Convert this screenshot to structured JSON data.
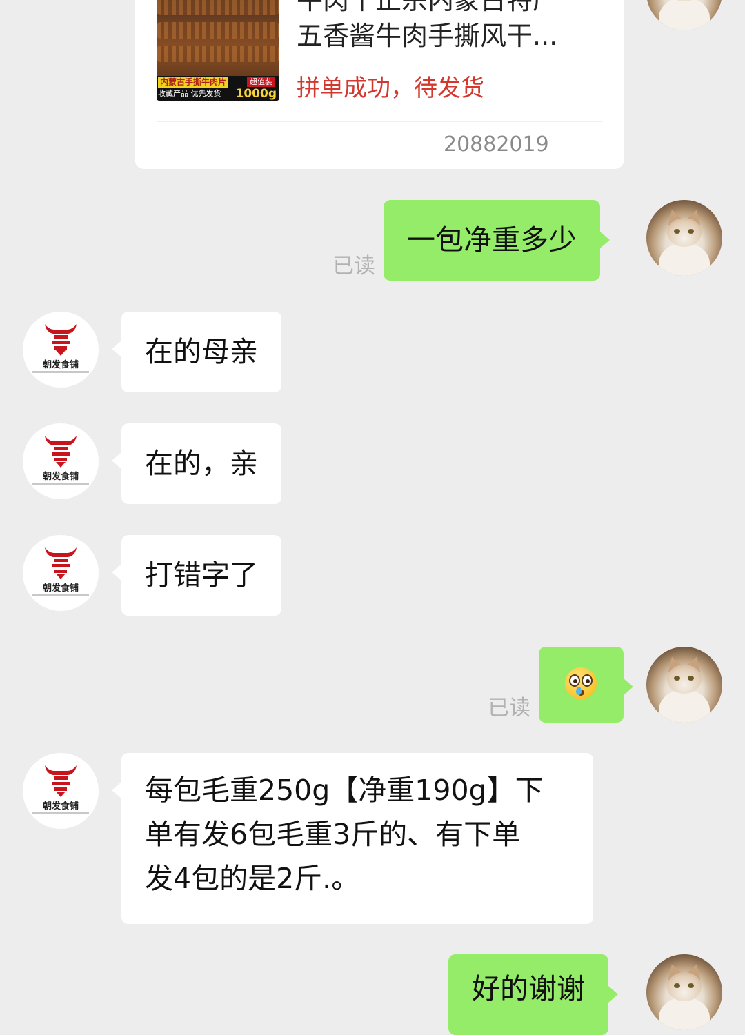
{
  "order_card": {
    "thumbnail": {
      "product_label": "内蒙古手撕牛肉片",
      "promo_line": "收藏产品 优先发货",
      "tag": "超值装",
      "weight": "1000g"
    },
    "title_line1": "牛肉干正宗内蒙古特产",
    "title_line2": "五香酱牛肉手撕风干...",
    "status": "拼单成功，待发货",
    "order_id_suffix": "20882019"
  },
  "messages": [
    {
      "id": "m1",
      "side": "out",
      "text": "一包净重多少",
      "read_label": "已读"
    },
    {
      "id": "m2",
      "side": "in",
      "text": "在的母亲"
    },
    {
      "id": "m3",
      "side": "in",
      "text": "在的，亲"
    },
    {
      "id": "m4",
      "side": "in",
      "text": "打错字了"
    },
    {
      "id": "m5",
      "side": "out",
      "emoji": "flushed-crying-face-emoji",
      "read_label": "已读"
    },
    {
      "id": "m6",
      "side": "in",
      "lines": [
        "每包毛重250g【净重190g】下",
        "单有发6包毛重3斤的、有下单",
        "发4包的是2斤.。"
      ]
    },
    {
      "id": "m7",
      "side": "out",
      "text": "好的谢谢"
    }
  ],
  "shop_avatar": {
    "name": "朝发食铺",
    "icon": "bull-head-logo"
  },
  "user_avatar": {
    "icon": "persian-cat-photo"
  },
  "colors": {
    "background": "#ededed",
    "bubble_out": "#95ec69",
    "bubble_in": "#ffffff",
    "status_red": "#d2382e",
    "logo_red": "#c8141c"
  }
}
